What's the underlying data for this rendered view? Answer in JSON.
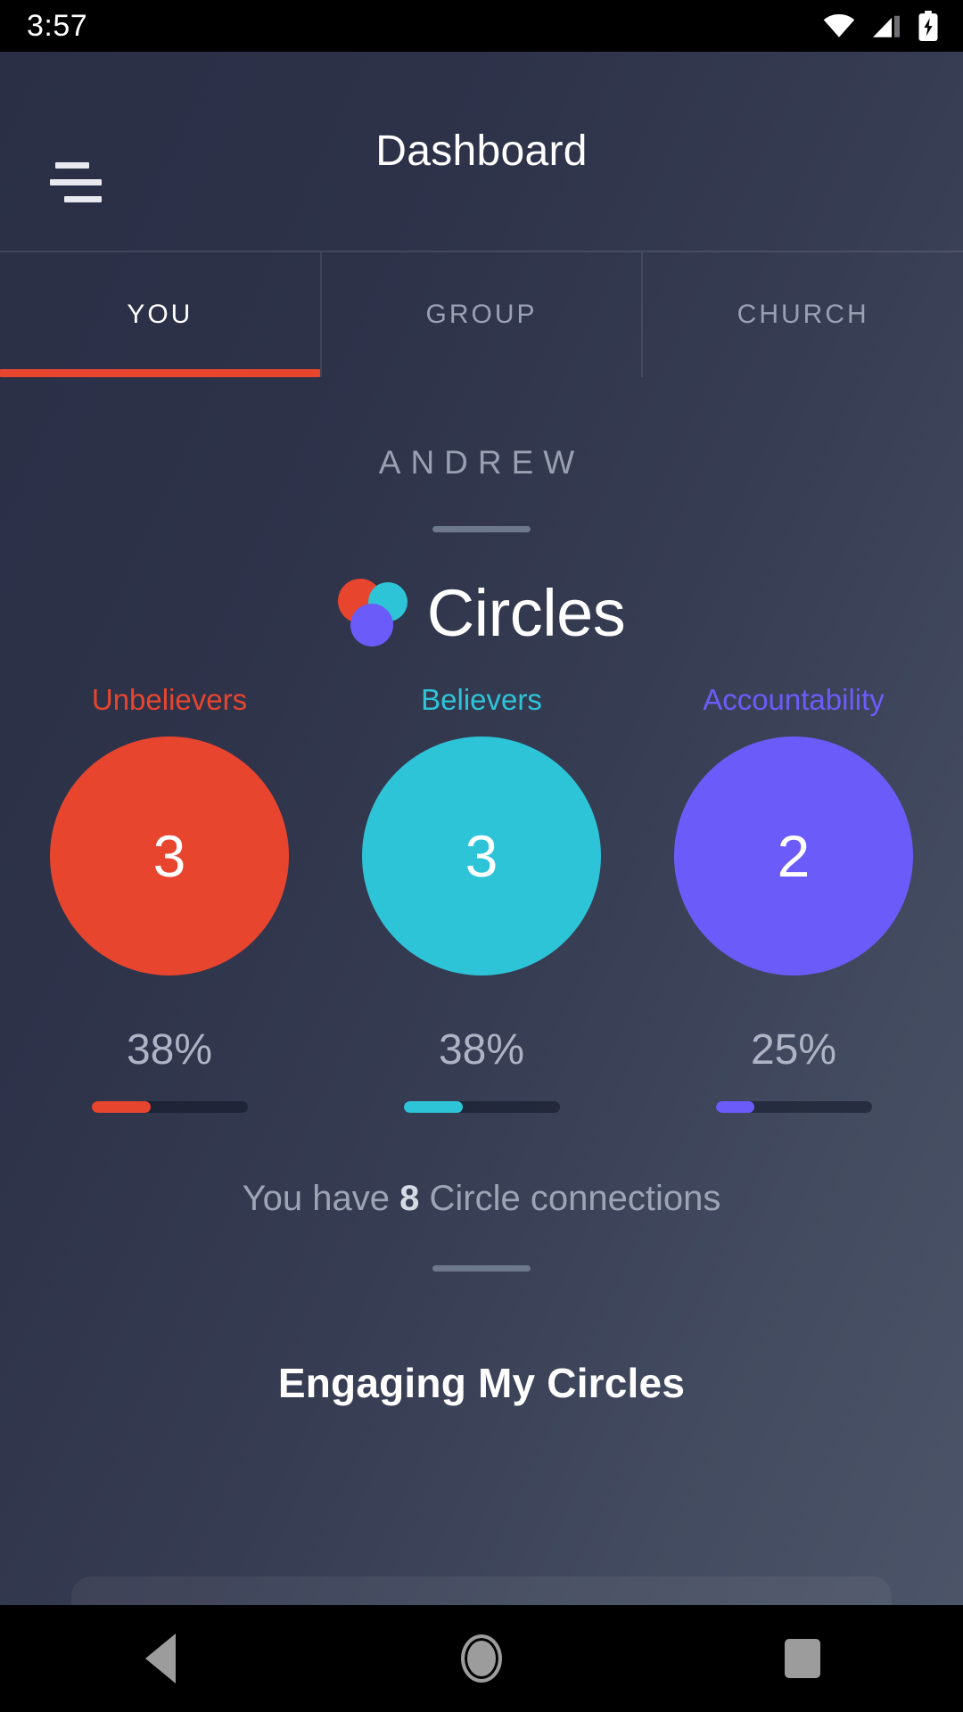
{
  "status_bar": {
    "time": "3:57",
    "icons": [
      "wifi-icon",
      "cellular-signal-icon",
      "battery-charging-icon"
    ]
  },
  "app_bar": {
    "title": "Dashboard",
    "menu_icon": "hamburger-menu-icon"
  },
  "tabs": [
    {
      "label": "YOU",
      "active": true
    },
    {
      "label": "GROUP",
      "active": false
    },
    {
      "label": "CHURCH",
      "active": false
    }
  ],
  "profile": {
    "name": "ANDREW"
  },
  "brand": {
    "title": "Circles",
    "logo_colors": {
      "red": "#E8452F",
      "cyan": "#2EC4D8",
      "purple": "#6B5CFA"
    }
  },
  "chart_data": {
    "type": "bar",
    "title": "Circles",
    "categories": [
      "Unbelievers",
      "Believers",
      "Accountability"
    ],
    "values": [
      3,
      3,
      2
    ],
    "percentages": [
      38,
      38,
      25
    ],
    "percent_labels": [
      "38%",
      "38%",
      "25%"
    ],
    "colors": [
      "#E8452F",
      "#2EC4D8",
      "#6B5CFA"
    ],
    "total": 8,
    "xlabel": "",
    "ylabel": "",
    "ylim": [
      0,
      8
    ]
  },
  "metrics": [
    {
      "label": "Unbelievers",
      "count": "3",
      "percent_label": "38%",
      "percent": 38,
      "color": "#E8452F"
    },
    {
      "label": "Believers",
      "count": "3",
      "percent_label": "38%",
      "percent": 38,
      "color": "#2EC4D8"
    },
    {
      "label": "Accountability",
      "count": "2",
      "percent_label": "25%",
      "percent": 25,
      "color": "#6B5CFA"
    }
  ],
  "summary": {
    "prefix": "You have ",
    "count": "8",
    "suffix": " Circle connections"
  },
  "section": {
    "heading": "Engaging My Circles"
  },
  "nav_bar": {
    "back": "back-triangle-icon",
    "home": "home-circle-icon",
    "recents": "recents-square-icon"
  },
  "theme": {
    "bg_dark": "#2B3048",
    "bg_light": "#4A5266",
    "accent_red": "#E8452F"
  }
}
